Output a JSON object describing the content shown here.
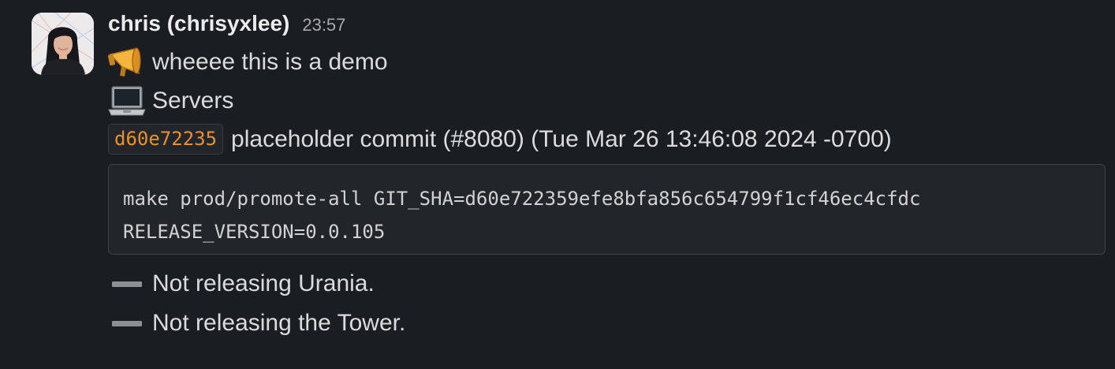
{
  "message": {
    "author": "chris (chrisyxlee)",
    "timestamp": "23:57",
    "lines": [
      {
        "icon": "megaphone-icon",
        "text": "wheeee this is a demo"
      },
      {
        "icon": "laptop-icon",
        "text": "Servers"
      }
    ],
    "commit": {
      "sha": "d60e72235",
      "text": "placeholder commit (#8080) (Tue Mar 26 13:46:08 2024 -0700)"
    },
    "code": [
      "make prod/promote-all GIT_SHA=d60e722359efe8bfa856c654799f1cf46ec4cfdc",
      "RELEASE_VERSION=0.0.105"
    ],
    "skips": [
      {
        "icon": "minus-icon",
        "text": "Not releasing Urania."
      },
      {
        "icon": "minus-icon",
        "text": "Not releasing the Tower."
      }
    ]
  },
  "colors": {
    "background": "#1a1d21",
    "text": "#d1d2d3",
    "sha": "#e8912d",
    "code_background": "#222529"
  }
}
